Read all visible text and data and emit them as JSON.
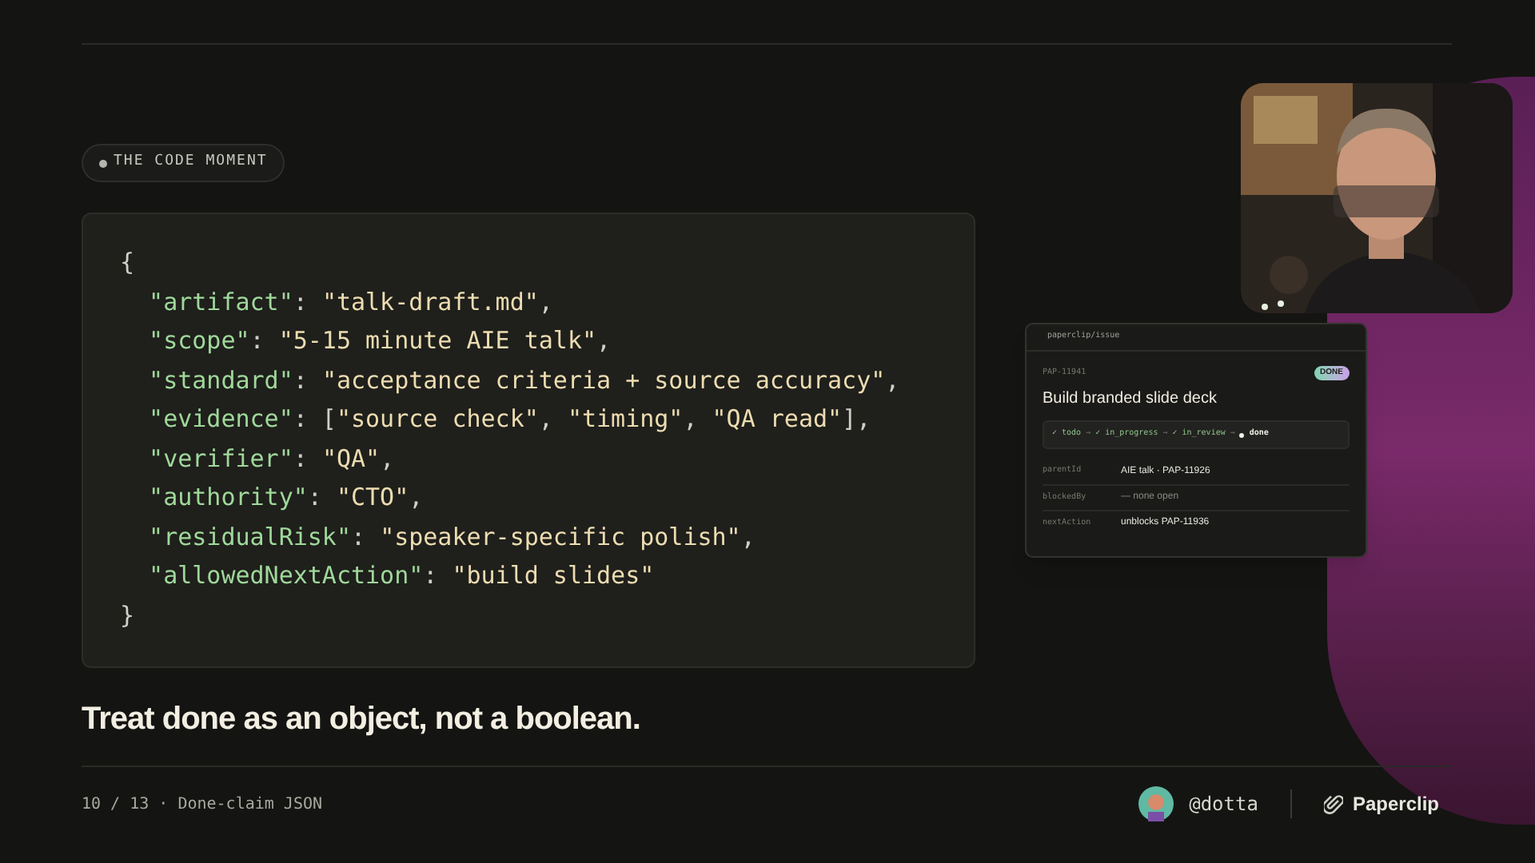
{
  "section_tag": "THE CODE MOMENT",
  "code": {
    "lines": [
      [
        {
          "kind": "punct",
          "text": "{"
        }
      ],
      [
        {
          "kind": "key",
          "text": "  \"artifact\""
        },
        {
          "kind": "punct",
          "text": ": "
        },
        {
          "kind": "string",
          "text": "\"talk-draft.md\""
        },
        {
          "kind": "punct",
          "text": ","
        }
      ],
      [
        {
          "kind": "key",
          "text": "  \"scope\""
        },
        {
          "kind": "punct",
          "text": ": "
        },
        {
          "kind": "string",
          "text": "\"5-15 minute AIE talk\""
        },
        {
          "kind": "punct",
          "text": ","
        }
      ],
      [
        {
          "kind": "key",
          "text": "  \"standard\""
        },
        {
          "kind": "punct",
          "text": ": "
        },
        {
          "kind": "string",
          "text": "\"acceptance criteria + source accuracy\""
        },
        {
          "kind": "punct",
          "text": ","
        }
      ],
      [
        {
          "kind": "key",
          "text": "  \"evidence\""
        },
        {
          "kind": "punct",
          "text": ": ["
        },
        {
          "kind": "string",
          "text": "\"source check\""
        },
        {
          "kind": "punct",
          "text": ", "
        },
        {
          "kind": "string",
          "text": "\"timing\""
        },
        {
          "kind": "punct",
          "text": ", "
        },
        {
          "kind": "string",
          "text": "\"QA read\""
        },
        {
          "kind": "punct",
          "text": "],"
        }
      ],
      [
        {
          "kind": "key",
          "text": "  \"verifier\""
        },
        {
          "kind": "punct",
          "text": ": "
        },
        {
          "kind": "string",
          "text": "\"QA\""
        },
        {
          "kind": "punct",
          "text": ","
        }
      ],
      [
        {
          "kind": "key",
          "text": "  \"authority\""
        },
        {
          "kind": "punct",
          "text": ": "
        },
        {
          "kind": "string",
          "text": "\"CTO\""
        },
        {
          "kind": "punct",
          "text": ","
        }
      ],
      [
        {
          "kind": "key",
          "text": "  \"residualRisk\""
        },
        {
          "kind": "punct",
          "text": ": "
        },
        {
          "kind": "string",
          "text": "\"speaker-specific polish\""
        },
        {
          "kind": "punct",
          "text": ","
        }
      ],
      [
        {
          "kind": "key",
          "text": "  \"allowedNextAction\""
        },
        {
          "kind": "punct",
          "text": ": "
        },
        {
          "kind": "string",
          "text": "\"build slides\""
        }
      ],
      [
        {
          "kind": "punct",
          "text": "}"
        }
      ]
    ]
  },
  "headline": "Treat done as an object, not a boolean.",
  "issue_card": {
    "path": "paperclip/issue",
    "id": "PAP-11941",
    "badge": "DONE",
    "title": "Build branded slide deck",
    "workflow": [
      {
        "label": "✓ todo",
        "current": false
      },
      {
        "label": "→",
        "current": false,
        "kind": "arrow"
      },
      {
        "label": "✓ in_progress",
        "current": false
      },
      {
        "label": "→",
        "current": false,
        "kind": "arrow"
      },
      {
        "label": "✓ in_review",
        "current": false
      },
      {
        "label": "→",
        "current": false,
        "kind": "arrow"
      },
      {
        "label": "done",
        "current": true
      }
    ],
    "fields": [
      {
        "label": "parentId",
        "value": "AIE talk · PAP-11926"
      },
      {
        "label": "blockedBy",
        "value": "— none open",
        "muted": true
      },
      {
        "label": "nextAction",
        "value": "unblocks PAP-11936"
      }
    ]
  },
  "footer": {
    "page": "10 / 13 · Done-claim JSON",
    "handle": "@dotta",
    "brand": "Paperclip"
  }
}
